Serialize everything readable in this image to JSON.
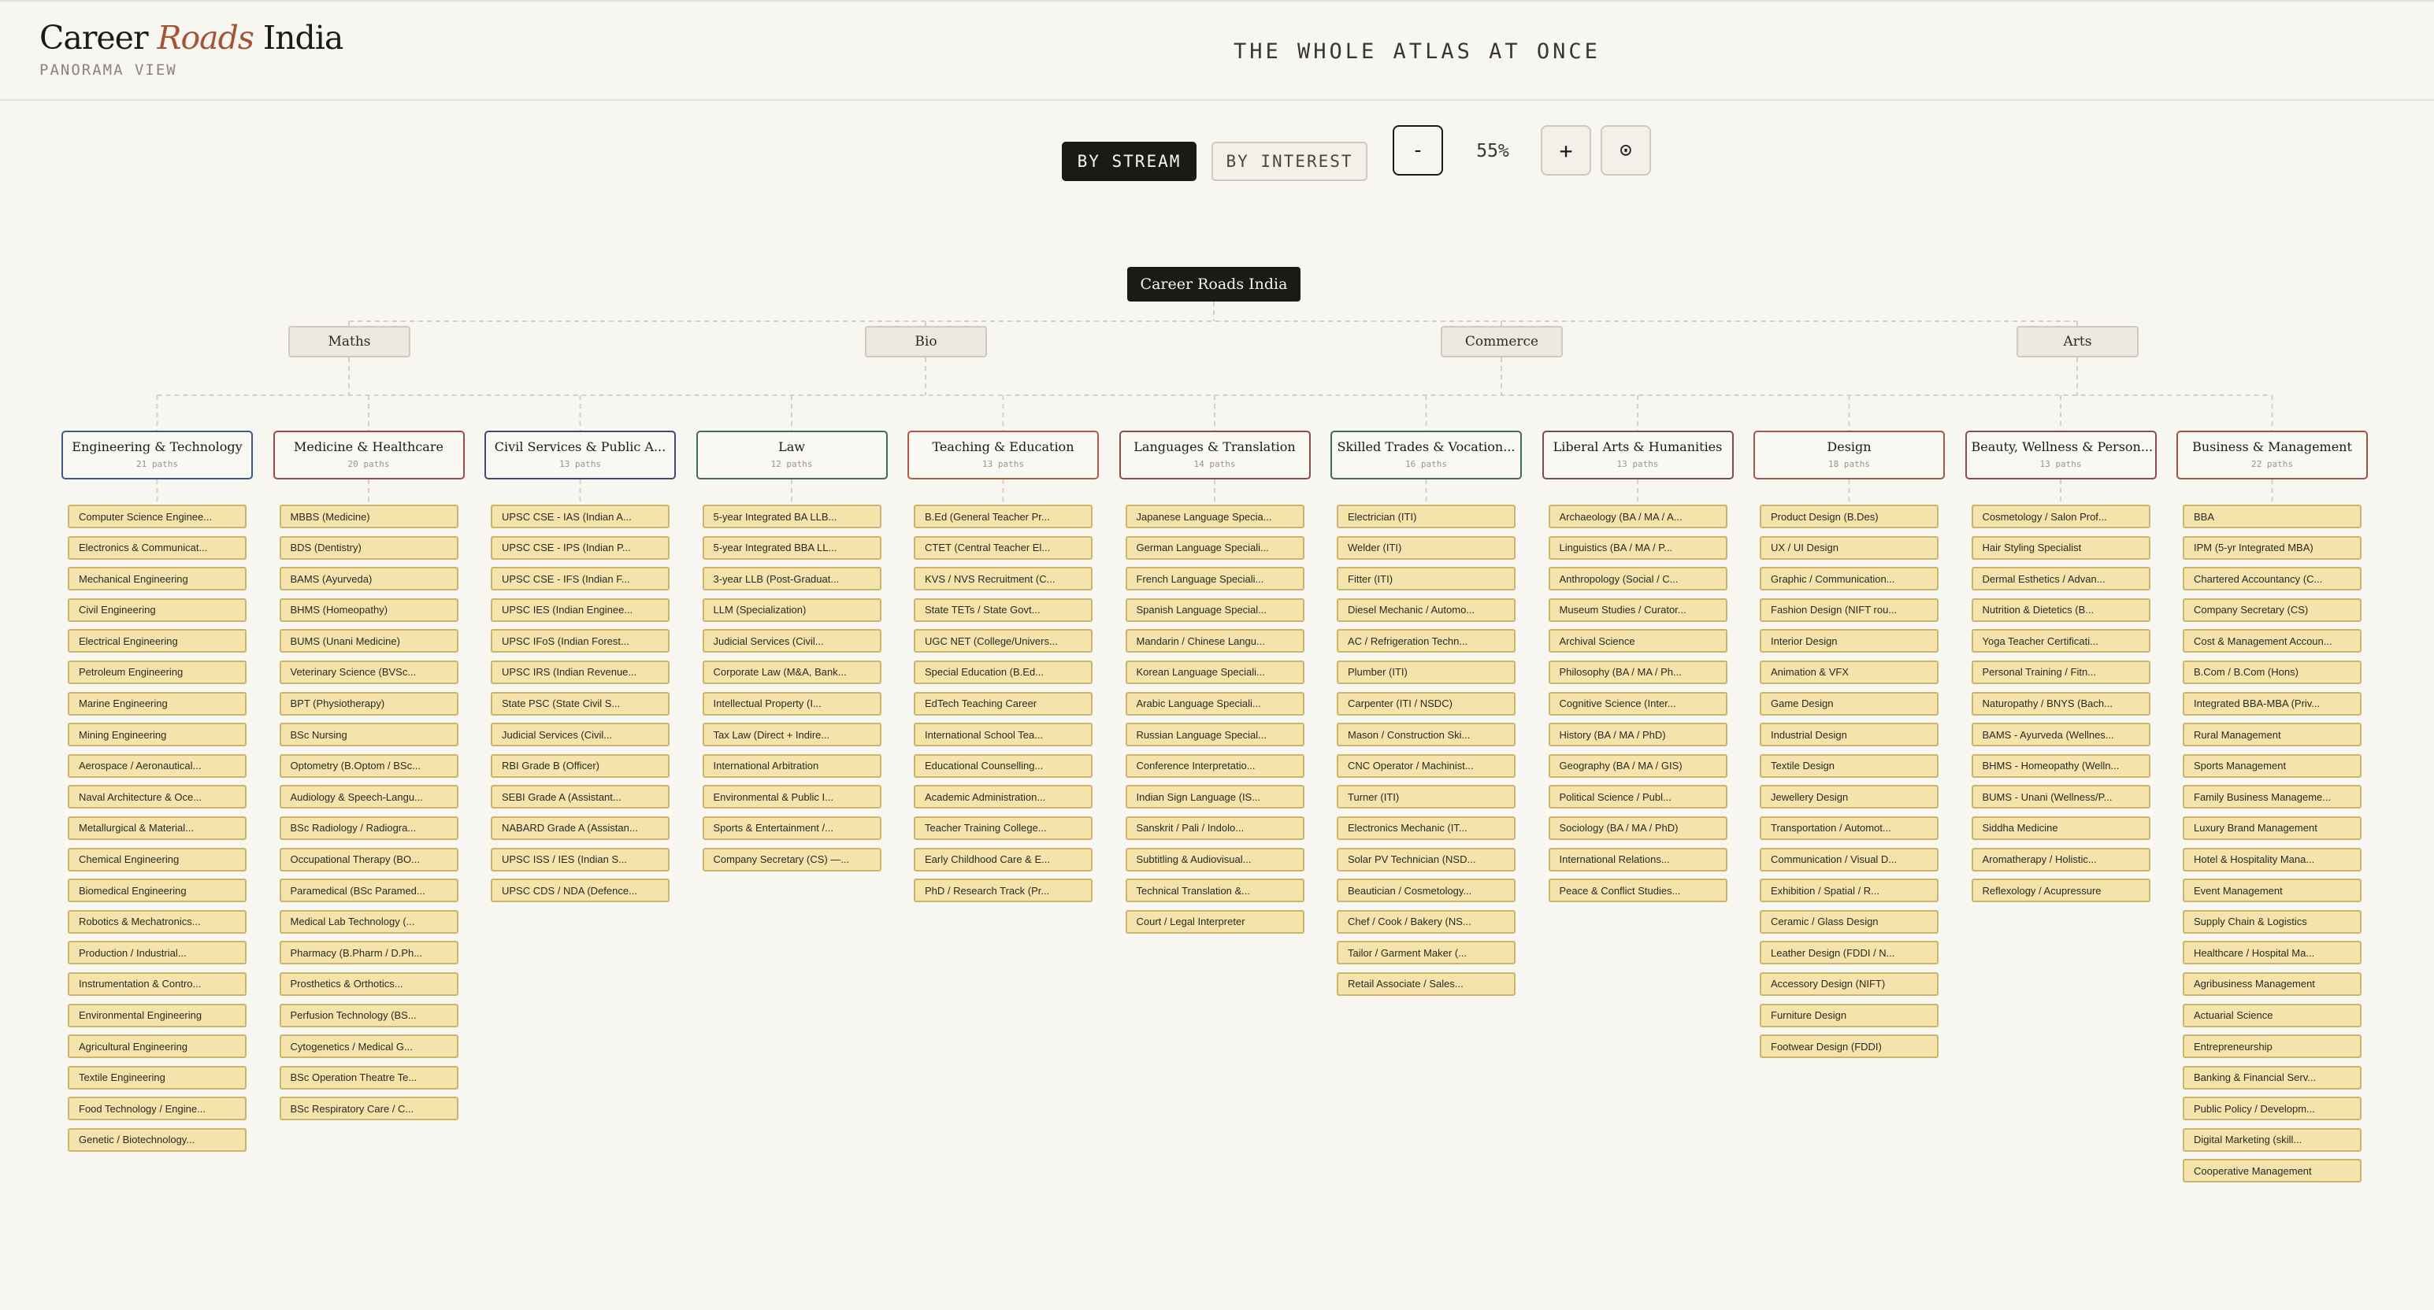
{
  "app": {
    "brand_pre": "Career ",
    "brand_accent": "Roads",
    "brand_post": " India",
    "subtitle": "PANORAMA VIEW",
    "center_title": "THE WHOLE ATLAS AT ONCE"
  },
  "toolbar": {
    "by_stream": "BY STREAM",
    "by_interest": "BY INTEREST",
    "zoom_out": "-",
    "zoom_level": "55%",
    "zoom_in": "+",
    "reset": "⊙",
    "active_mode": "by_stream"
  },
  "tree": {
    "root": "Career Roads India",
    "streams": [
      "Maths",
      "Bio",
      "Commerce",
      "Arts"
    ],
    "categories": [
      {
        "name": "Engineering & Technology",
        "count": "21 paths",
        "border": "#3b5b86",
        "careers": [
          "Computer Science Enginee...",
          "Electronics & Communicat...",
          "Mechanical Engineering",
          "Civil Engineering",
          "Electrical Engineering",
          "Petroleum Engineering",
          "Marine Engineering",
          "Mining Engineering",
          "Aerospace / Aeronautical...",
          "Naval Architecture & Oce...",
          "Metallurgical & Material...",
          "Chemical Engineering",
          "Biomedical Engineering",
          "Robotics & Mechatronics...",
          "Production / Industrial...",
          "Instrumentation & Contro...",
          "Environmental Engineering",
          "Agricultural Engineering",
          "Textile Engineering",
          "Food Technology / Engine...",
          "Genetic / Biotechnology..."
        ]
      },
      {
        "name": "Medicine & Healthcare",
        "count": "20 paths",
        "border": "#a4474a",
        "careers": [
          "MBBS (Medicine)",
          "BDS (Dentistry)",
          "BAMS (Ayurveda)",
          "BHMS (Homeopathy)",
          "BUMS (Unani Medicine)",
          "Veterinary Science (BVSc...",
          "BPT (Physiotherapy)",
          "BSc Nursing",
          "Optometry (B.Optom / BSc...",
          "Audiology & Speech-Langu...",
          "BSc Radiology / Radiogra...",
          "Occupational Therapy (BO...",
          "Paramedical (BSc Paramed...",
          "Medical Lab Technology (...",
          "Pharmacy (B.Pharm / D.Ph...",
          "Prosthetics & Orthotics...",
          "Perfusion Technology (BS...",
          "Cytogenetics / Medical G...",
          "BSc Operation Theatre Te...",
          "BSc Respiratory Care / C..."
        ]
      },
      {
        "name": "Civil Services & Public A...",
        "count": "13 paths",
        "border": "#3e4a7c",
        "careers": [
          "UPSC CSE - IAS (Indian A...",
          "UPSC CSE - IPS (Indian P...",
          "UPSC CSE - IFS (Indian F...",
          "UPSC IES (Indian Enginee...",
          "UPSC IFoS (Indian Forest...",
          "UPSC IRS (Indian Revenue...",
          "State PSC (State Civil S...",
          "Judicial Services (Civil...",
          "RBI Grade B (Officer)",
          "SEBI Grade A (Assistant...",
          "NABARD Grade A (Assistan...",
          "UPSC ISS / IES (Indian S...",
          "UPSC CDS / NDA (Defence..."
        ]
      },
      {
        "name": "Law",
        "count": "12 paths",
        "border": "#3f6b5c",
        "careers": [
          "5-year Integrated BA LLB...",
          "5-year Integrated BBA LL...",
          "3-year LLB (Post-Graduat...",
          "LLM (Specialization)",
          "Judicial Services (Civil...",
          "Corporate Law (M&A, Bank...",
          "Intellectual Property (I...",
          "Tax Law (Direct + Indire...",
          "International Arbitration",
          "Environmental & Public I...",
          "Sports & Entertainment /...",
          "Company Secretary (CS) —..."
        ]
      },
      {
        "name": "Teaching & Education",
        "count": "13 paths",
        "border": "#b25a46",
        "careers": [
          "B.Ed (General Teacher Pr...",
          "CTET (Central Teacher El...",
          "KVS / NVS Recruitment (C...",
          "State TETs / State Govt...",
          "UGC NET (College/Univers...",
          "Special Education (B.Ed...",
          "EdTech Teaching Career",
          "International School Tea...",
          "Educational Counselling...",
          "Academic Administration...",
          "Teacher Training College...",
          "Early Childhood Care & E...",
          "PhD / Research Track (Pr..."
        ]
      },
      {
        "name": "Languages & Translation",
        "count": "14 paths",
        "border": "#8a4d4a",
        "careers": [
          "Japanese Language Specia...",
          "German Language Speciali...",
          "French Language Speciali...",
          "Spanish Language Special...",
          "Mandarin / Chinese Langu...",
          "Korean Language Speciali...",
          "Arabic Language Speciali...",
          "Russian Language Special...",
          "Conference Interpretatio...",
          "Indian Sign Language (IS...",
          "Sanskrit / Pali / Indolo...",
          "Subtitling & Audiovisual...",
          "Technical Translation &...",
          "Court / Legal Interpreter"
        ]
      },
      {
        "name": "Skilled Trades & Vocation...",
        "count": "16 paths",
        "border": "#3e6a5f",
        "careers": [
          "Electrician (ITI)",
          "Welder (ITI)",
          "Fitter (ITI)",
          "Diesel Mechanic / Automo...",
          "AC / Refrigeration Techn...",
          "Plumber (ITI)",
          "Carpenter (ITI / NSDC)",
          "Mason / Construction Ski...",
          "CNC Operator / Machinist...",
          "Turner (ITI)",
          "Electronics Mechanic (IT...",
          "Solar PV Technician (NSD...",
          "Beautician / Cosmetology...",
          "Chef / Cook / Bakery (NS...",
          "Tailor / Garment Maker (...",
          "Retail Associate / Sales..."
        ]
      },
      {
        "name": "Liberal Arts & Humanities",
        "count": "13 paths",
        "border": "#7a4a5e",
        "careers": [
          "Archaeology (BA / MA / A...",
          "Linguistics (BA / MA / P...",
          "Anthropology (Social / C...",
          "Museum Studies / Curator...",
          "Archival Science",
          "Philosophy (BA / MA / Ph...",
          "Cognitive Science (Inter...",
          "History (BA / MA / PhD)",
          "Geography (BA / MA / GIS)",
          "Political Science / Publ...",
          "Sociology (BA / MA / PhD)",
          "International Relations...",
          "Peace & Conflict Studies..."
        ]
      },
      {
        "name": "Design",
        "count": "18 paths",
        "border": "#a65448",
        "careers": [
          "Product Design (B.Des)",
          "UX / UI Design",
          "Graphic / Communication...",
          "Fashion Design (NIFT rou...",
          "Interior Design",
          "Animation & VFX",
          "Game Design",
          "Industrial Design",
          "Textile Design",
          "Jewellery Design",
          "Transportation / Automot...",
          "Communication / Visual D...",
          "Exhibition / Spatial / R...",
          "Ceramic / Glass Design",
          "Leather Design (FDDI / N...",
          "Accessory Design (NIFT)",
          "Furniture Design",
          "Footwear Design (FDDI)"
        ]
      },
      {
        "name": "Beauty, Wellness & Person...",
        "count": "13 paths",
        "border": "#8b4a5e",
        "careers": [
          "Cosmetology / Salon Prof...",
          "Hair Styling Specialist",
          "Dermal Esthetics / Advan...",
          "Nutrition & Dietetics (B...",
          "Yoga Teacher Certificati...",
          "Personal Training / Fitn...",
          "Naturopathy / BNYS (Bach...",
          "BAMS - Ayurveda (Wellnes...",
          "BHMS - Homeopathy (Welln...",
          "BUMS - Unani (Wellness/P...",
          "Siddha Medicine",
          "Aromatherapy / Holistic...",
          "Reflexology / Acupressure"
        ]
      },
      {
        "name": "Business & Management",
        "count": "22 paths",
        "border": "#a8503f",
        "careers": [
          "BBA",
          "IPM (5-yr Integrated MBA)",
          "Chartered Accountancy (C...",
          "Company Secretary (CS)",
          "Cost & Management Accoun...",
          "B.Com / B.Com (Hons)",
          "Integrated BBA-MBA (Priv...",
          "Rural Management",
          "Sports Management",
          "Family Business Manageme...",
          "Luxury Brand Management",
          "Hotel & Hospitality Mana...",
          "Event Management",
          "Supply Chain & Logistics",
          "Healthcare / Hospital Ma...",
          "Agribusiness Management",
          "Actuarial Science",
          "Entrepreneurship",
          "Banking & Financial Serv...",
          "Public Policy / Developm...",
          "Digital Marketing (skill...",
          "Cooperative Management"
        ]
      }
    ]
  }
}
